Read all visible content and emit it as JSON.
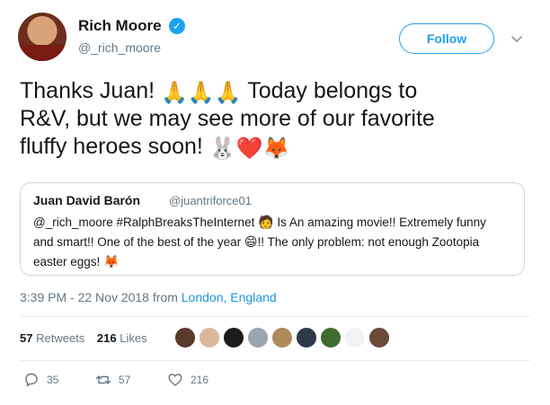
{
  "user": {
    "name": "Rich Moore",
    "handle": "@_rich_moore",
    "verified_glyph": "✓"
  },
  "follow_label": "Follow",
  "tweet": {
    "line_1a": "Thanks Juan!",
    "line_1_emoji": "🙏🙏🙏",
    "line_1b": "Today belongs to",
    "line_2": "R&V, but we may see more of our favorite",
    "line_3": "fluffy heroes soon!",
    "line_3_emoji": "🐰❤️🦊"
  },
  "quoted": {
    "name": "Juan David Barón",
    "handle": "@juantriforce01",
    "text_1": "@_rich_moore #RalphBreaksTheInternet",
    "emoji_1": "🧑",
    "text_2": "Is An amazing movie!! Extremely funny",
    "text_3": "and smart!! One of the best of the year",
    "emoji_2": "😄",
    "text_4": "!! The only problem: not enough Zootopia",
    "text_5": "easter eggs!",
    "emoji_3": "🦊"
  },
  "meta": {
    "time": "3:39 PM - 22 Nov 2018 from",
    "location": "London, England"
  },
  "stats": {
    "retweets_count": "57",
    "retweets_label": "Retweets",
    "likes_count": "216",
    "likes_label": "Likes"
  },
  "liker_colors": [
    "#5a3a2a",
    "#d9b89a",
    "#1c1c1c",
    "#9aa5b1",
    "#b08a5a",
    "#2d3a4a",
    "#3f6b2e",
    "#f2f2f2",
    "#6b4a3a"
  ],
  "actions": {
    "replies": "35",
    "retweets": "57",
    "likes": "216"
  },
  "colors": {
    "accent": "#1da1f2",
    "link": "#1b95e0",
    "muted": "#657786",
    "heart": "#e0245e"
  }
}
